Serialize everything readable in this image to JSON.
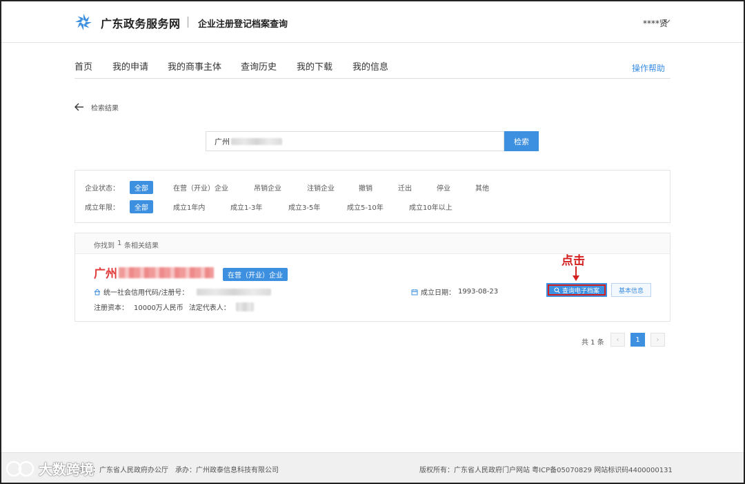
{
  "header": {
    "brand": "广东政务服务网",
    "subtitle": "企业注册登记档案查询",
    "user": "****贤"
  },
  "nav": {
    "items": [
      "首页",
      "我的申请",
      "我的商事主体",
      "查询历史",
      "我的下载",
      "我的信息"
    ],
    "help": "操作帮助"
  },
  "back_label": "检索结果",
  "search": {
    "value": "广州",
    "button": "检索"
  },
  "filters": {
    "status_label": "企业状态：",
    "status_options": [
      "全部",
      "在营（开业）企业",
      "吊销企业",
      "注销企业",
      "撤销",
      "迁出",
      "停业",
      "其他"
    ],
    "age_label": "成立年限：",
    "age_options": [
      "全部",
      "成立1年内",
      "成立1-3年",
      "成立3-5年",
      "成立5-10年",
      "成立10年以上"
    ]
  },
  "results": {
    "found_prefix": "你找到",
    "count": "1",
    "found_suffix": "条相关结果",
    "company_prefix": "广州",
    "status_tag": "在营（开业）企业",
    "credit_label": "统一社会信用代码/注册号：",
    "established_label": "成立日期：",
    "established_date": "1993-08-23",
    "capital_label": "注册资本：",
    "capital_value": "10000万人民币",
    "legal_rep_label": "法定代表人：",
    "archive_button": "查询电子档案",
    "basic_button": "基本信息",
    "annotation": "点击"
  },
  "pagination": {
    "total": "共 1 条",
    "prev": "‹",
    "current": "1",
    "next": "›"
  },
  "footer": {
    "host": "主办：广东省人民政府办公厅",
    "contractor": "承办：广州政泰信息科技有限公司",
    "rights": "版权所有：广东省人民政府门户网站 粤ICP备05070829 网站标识码4400000131"
  },
  "watermark": "大数跨境",
  "colors": {
    "accent": "#3d8fe0",
    "highlight": "#d32020"
  }
}
